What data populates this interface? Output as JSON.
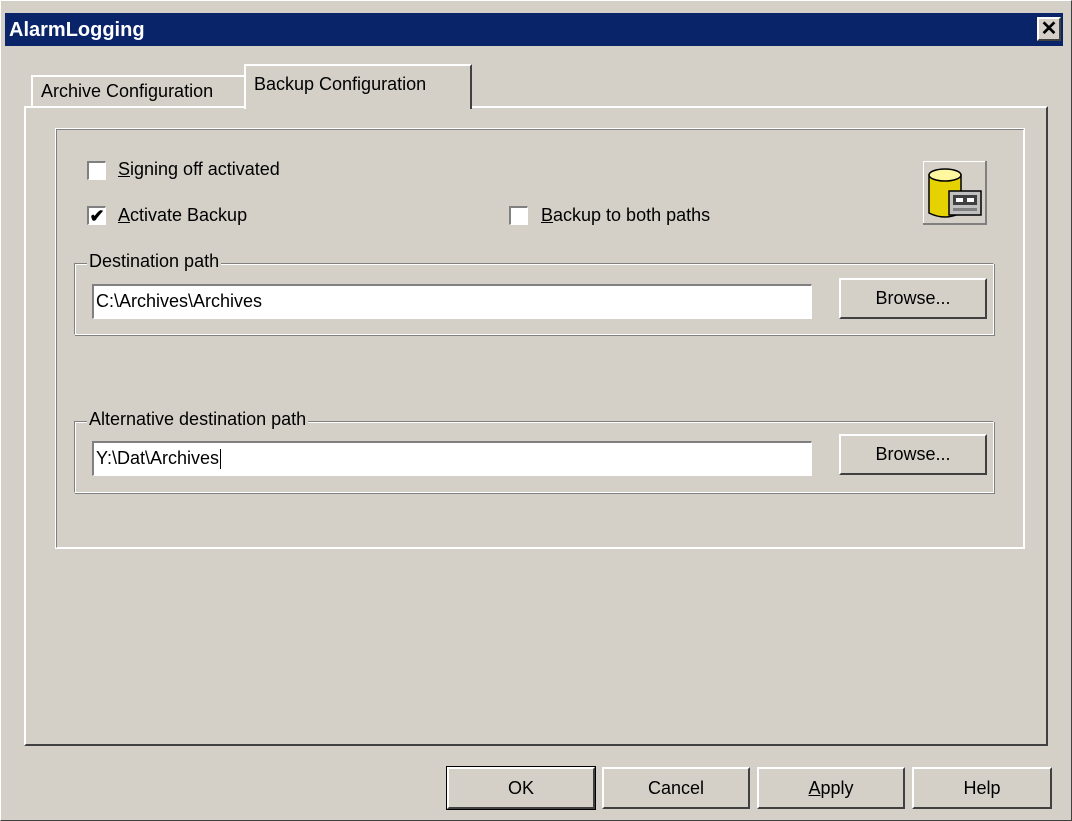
{
  "window": {
    "title": "AlarmLogging",
    "close_symbol": "✕"
  },
  "tabs": [
    {
      "label": "Archive Configuration",
      "active": false
    },
    {
      "label": "Backup Configuration",
      "active": true
    }
  ],
  "options": {
    "signing_off": {
      "label_prefix": "",
      "label_underline": "S",
      "label_rest": "igning off activated",
      "checked": false
    },
    "activate_backup": {
      "label_prefix": "",
      "label_underline": "A",
      "label_rest": "ctivate Backup",
      "checked": true
    },
    "backup_both": {
      "label_prefix": "",
      "label_underline": "B",
      "label_rest": "ackup to both paths",
      "checked": false
    },
    "check_mark": "✔"
  },
  "destination": {
    "legend": "Destination path",
    "value": "C:\\Archives\\Archives",
    "browse_label": "Browse..."
  },
  "alt_destination": {
    "legend": "Alternative destination path",
    "value": "Y:\\Dat\\Archives",
    "browse_label": "Browse..."
  },
  "footer": {
    "ok_label": "OK",
    "cancel_label": "Cancel",
    "apply_underline": "A",
    "apply_rest": "pply",
    "help_label": "Help"
  },
  "icons": {
    "backup": "database-backup-icon"
  }
}
